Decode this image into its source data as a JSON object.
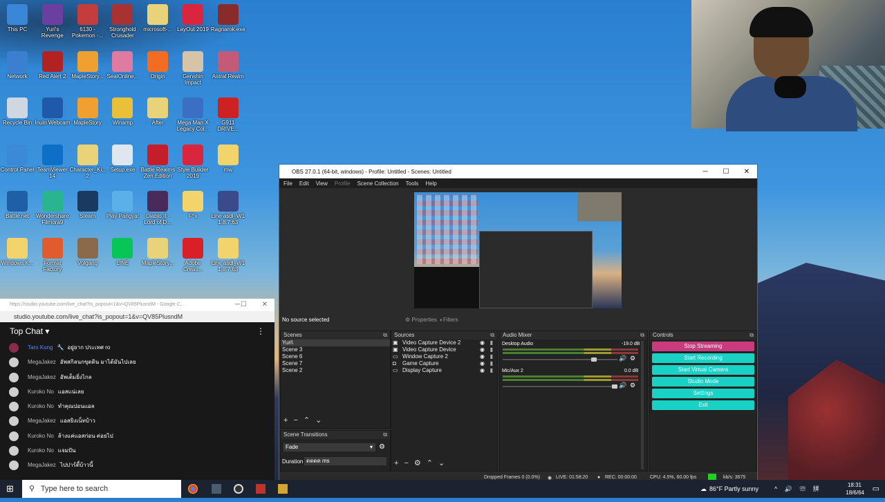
{
  "desktop": {
    "icons": [
      {
        "label": "This PC",
        "color": "#3b87d7"
      },
      {
        "label": "Yuri's Revenge",
        "color": "#6b3fa0"
      },
      {
        "label": "6130 - Pokemon -...",
        "color": "#c43c3c"
      },
      {
        "label": "Stronghold Crusader",
        "color": "#a83232"
      },
      {
        "label": "microsoft-...",
        "color": "#e8d27a"
      },
      {
        "label": "LayOut 2019",
        "color": "#d9263e"
      },
      {
        "label": "Ragnarok.exe",
        "color": "#8a2b2b"
      },
      {
        "label": "Network",
        "color": "#3a7fd0"
      },
      {
        "label": "Red Alert 2",
        "color": "#b32222"
      },
      {
        "label": "MapleStory...",
        "color": "#f0a030"
      },
      {
        "label": "SealOnline...",
        "color": "#e07aa0"
      },
      {
        "label": "Origin",
        "color": "#f26c22"
      },
      {
        "label": "Genshin Impact",
        "color": "#d6c3a8"
      },
      {
        "label": "Astral Realm",
        "color": "#c25a78"
      },
      {
        "label": "Recycle Bin",
        "color": "#cfd8e0"
      },
      {
        "label": "Inuin Webcam",
        "color": "#1e5aa8"
      },
      {
        "label": "MapleStory",
        "color": "#f0a030"
      },
      {
        "label": "Winamp",
        "color": "#e8c03a"
      },
      {
        "label": "After",
        "color": "#e8d27a"
      },
      {
        "label": "Mega Man X Legacy Col...",
        "color": "#3a6fc4"
      },
      {
        "label": "G911 DRIVE...",
        "color": "#c22"
      },
      {
        "label": "Control Panel",
        "color": "#3a8ad8"
      },
      {
        "label": "TeamViewer 14",
        "color": "#0e6fc7"
      },
      {
        "label": "Character_Ki... 2",
        "color": "#e8d27a"
      },
      {
        "label": "Setup.exe",
        "color": "#dfe7ee"
      },
      {
        "label": "Battle Realms Zen Edition",
        "color": "#c41e2a"
      },
      {
        "label": "Style Builder 2019",
        "color": "#d9263e"
      },
      {
        "label": "mw",
        "color": "#f3d36b"
      },
      {
        "label": "Battle.net",
        "color": "#1f5fa8"
      },
      {
        "label": "Wondershare Filmora9",
        "color": "#2bb58f"
      },
      {
        "label": "Steam",
        "color": "#1b3a5f"
      },
      {
        "label": "Play Pangya!",
        "color": "#5cb0e8"
      },
      {
        "label": "Diablo II - Lord of D...",
        "color": "#4a2a5a"
      },
      {
        "label": "F^x",
        "color": "#f3d36b"
      },
      {
        "label": "Line asdl_W1 1.8.7.63",
        "color": "#3a4a8a"
      },
      {
        "label": "Windows K...",
        "color": "#f3d36b"
      },
      {
        "label": "Format Factory",
        "color": "#e05c2c"
      },
      {
        "label": "Volgang",
        "color": "#8a6a4a"
      },
      {
        "label": "LINE",
        "color": "#06c755"
      },
      {
        "label": "MapleStory...",
        "color": "#e8d27a"
      },
      {
        "label": "Adobe Creati...",
        "color": "#da1f26"
      },
      {
        "label": "Line asdl_W1 1.8.7.63",
        "color": "#f3d36b"
      }
    ]
  },
  "obs": {
    "title": "OBS 27.0.1 (64-bit, windows) - Profile: Untitled - Scenes: Untitled",
    "menu": [
      "File",
      "Edit",
      "View",
      "Profile",
      "Scene Collection",
      "Tools",
      "Help"
    ],
    "source_bar": {
      "status": "No source selected",
      "properties": "Properties",
      "filters": "Filters"
    },
    "scenes": {
      "title": "Scenes",
      "items": [
        "Yuri\\",
        "Scene 3",
        "Scene 6",
        "Scene 7",
        "Scene 2"
      ]
    },
    "sources": {
      "title": "Sources",
      "items": [
        "Video Capture Device 2",
        "Video Capture Device",
        "Window Capture 2",
        "Game Capture",
        "Display Capture"
      ]
    },
    "audio": {
      "title": "Audio Mixer",
      "channels": [
        {
          "name": "Desktop Audio",
          "db": "-19.0 dB",
          "level": 0.82
        },
        {
          "name": "Mic/Aux 2",
          "db": "0.0 dB",
          "level": 1.0
        }
      ]
    },
    "controls": {
      "title": "Controls",
      "buttons": [
        "Stop Streaming",
        "Start Recording",
        "Start Virtual Camera",
        "Studio Mode",
        "Settings",
        "Exit"
      ]
    },
    "transitions": {
      "title": "Scene Transitions",
      "type": "Fade",
      "duration_label": "Duration",
      "duration_value": "ดดดด ms"
    },
    "status": {
      "dropped": "Dropped Frames 0 (0.0%)",
      "live": "LIVE: 01:58:20",
      "rec": "REC: 00:00:00",
      "cpu": "CPU: 4.5%, 60.00 fps",
      "kbps": "kb/s: 3675"
    }
  },
  "chat": {
    "tab_url": "https://studio.youtube.com/live_chat?is_popout=1&v=QV85PlusndM - Google C...",
    "url": "studio.youtube.com/live_chat?is_popout=1&v=QV85PlusndM",
    "title": "Top Chat",
    "messages": [
      {
        "name": "Taro Kung",
        "text": "อยู่ยาก ประเทศ ro",
        "mod": true
      },
      {
        "name": "MegaJakez",
        "text": "อัพสกิลนกขุดดิน มาได้มันไปเลย",
        "mod": false
      },
      {
        "name": "MegaJakez",
        "text": "อัพเต็มยิ่งไกล",
        "mod": false
      },
      {
        "name": "Kuroko No",
        "text": "แอสแน่เลย",
        "mod": false
      },
      {
        "name": "Kuroko No",
        "text": "ทำคุณปอนแอล",
        "mod": false
      },
      {
        "name": "MegaJakez",
        "text": "แอสยิงเน็ทบ้าว",
        "mod": false
      },
      {
        "name": "Kuroko No",
        "text": "ล้างแค่แอสก่อน ค่อยไป",
        "mod": false
      },
      {
        "name": "Kuroko No",
        "text": "แจมปัน",
        "mod": false
      },
      {
        "name": "MegaJakez",
        "text": "ไปปาร์ตี้บ้าวนี้",
        "mod": false
      }
    ]
  },
  "taskbar": {
    "search_placeholder": "Type here to search",
    "weather": "86°F  Partly sunny",
    "time": "18:31",
    "date": "18/6/64"
  }
}
